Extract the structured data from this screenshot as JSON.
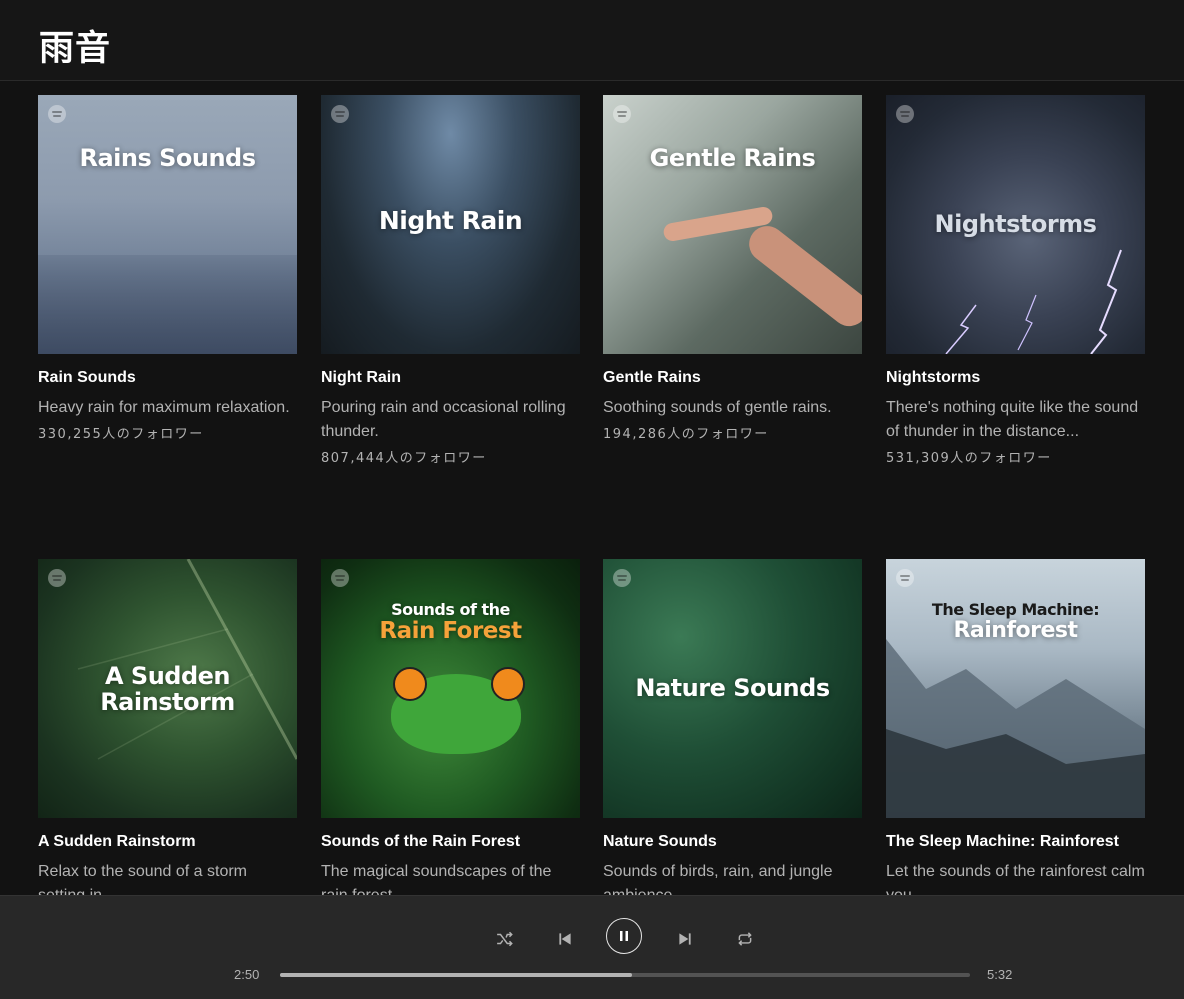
{
  "header": {
    "title": "雨音"
  },
  "playlists": [
    {
      "cover_lines": [
        "Rains Sounds"
      ],
      "name": "Rain Sounds",
      "description": "Heavy rain for maximum relaxation.",
      "followers": "330,255人のフォロワー"
    },
    {
      "cover_lines": [
        "Night Rain"
      ],
      "name": "Night Rain",
      "description": "Pouring rain and occasional rolling thunder.",
      "followers": "807,444人のフォロワー"
    },
    {
      "cover_lines": [
        "Gentle Rains"
      ],
      "name": "Gentle Rains",
      "description": "Soothing sounds of gentle rains.",
      "followers": "194,286人のフォロワー"
    },
    {
      "cover_lines": [
        "Nightstorms"
      ],
      "name": "Nightstorms",
      "description": "There's nothing quite like the sound of thunder in the distance...",
      "followers": "531,309人のフォロワー"
    },
    {
      "cover_lines": [
        "A Sudden",
        "Rainstorm"
      ],
      "name": "A Sudden Rainstorm",
      "description": "Relax to the sound of a storm setting in.",
      "followers": ""
    },
    {
      "cover_lines": [
        "Sounds of the",
        "Rain Forest"
      ],
      "name": "Sounds of the Rain Forest",
      "description": "The magical soundscapes of the rain forest.",
      "followers": ""
    },
    {
      "cover_lines": [
        "Nature Sounds"
      ],
      "name": "Nature Sounds",
      "description": "Sounds of birds, rain, and jungle ambience.",
      "followers": ""
    },
    {
      "cover_lines": [
        "The Sleep Machine:",
        "Rainforest"
      ],
      "name": "The Sleep Machine: Rainforest",
      "description": "Let the sounds of the rainforest calm you.",
      "followers": ""
    }
  ],
  "player": {
    "elapsed": "2:50",
    "duration": "5:32",
    "progress": 0.51,
    "state": "playing",
    "controls": [
      "shuffle-icon",
      "previous-icon",
      "pause-icon",
      "next-icon",
      "repeat-icon"
    ]
  },
  "colors": {
    "background": "#121212",
    "player_bar": "#282828",
    "secondary_text": "#b3b3b3",
    "rain_forest_accent": "#f5a23a"
  }
}
